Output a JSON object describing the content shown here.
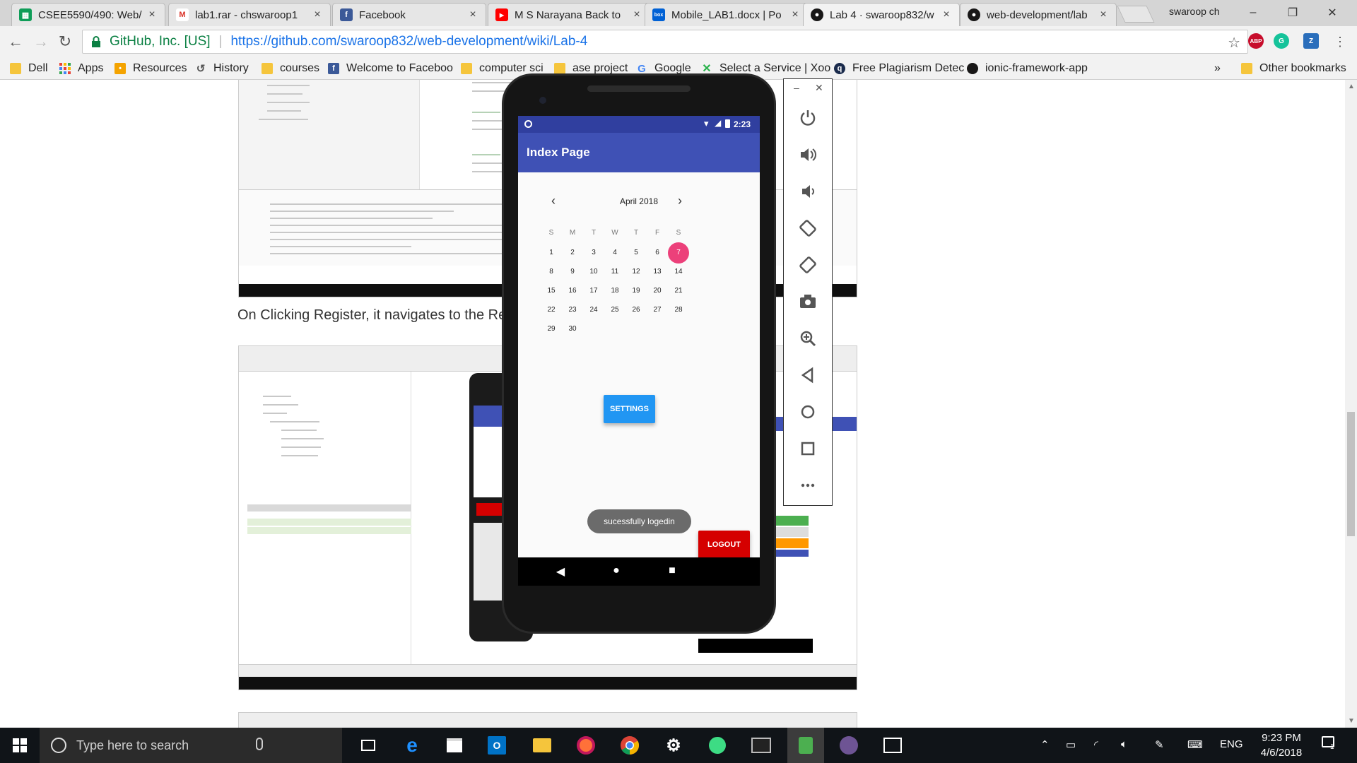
{
  "browser": {
    "tabs": [
      {
        "title": "CSEE5590/490: Web/C",
        "favicon_color": "#0f9d58",
        "favicon_text": ""
      },
      {
        "title": "lab1.rar - chswaroop1",
        "favicon_color": "#d93025",
        "favicon_text": "M"
      },
      {
        "title": "Facebook",
        "favicon_color": "#3b5998",
        "favicon_text": "f"
      },
      {
        "title": "M S Narayana Back to",
        "favicon_color": "#ff0000",
        "favicon_text": "▶"
      },
      {
        "title": "Mobile_LAB1.docx | Po",
        "favicon_color": "#0061d5",
        "favicon_text": "box"
      },
      {
        "title": "Lab 4 · swaroop832/w",
        "favicon_color": "#181717",
        "favicon_text": ""
      },
      {
        "title": "web-development/lab",
        "favicon_color": "#181717",
        "favicon_text": ""
      }
    ],
    "profile_name": "swaroop ch",
    "window_controls": {
      "minimize": "–",
      "restore": "❐",
      "close": "✕"
    },
    "address": {
      "site_identity": "GitHub, Inc. [US]",
      "separator": "|",
      "url": "https://github.com/swaroop832/web-development/wiki/Lab-4"
    },
    "extensions": [
      {
        "name": "adblock-plus",
        "text": "ABP",
        "color": "#c70d2c"
      },
      {
        "name": "grammarly",
        "text": "G",
        "color": "#15c39a"
      },
      {
        "name": "zotero",
        "text": "Z",
        "color": "#2a6ebb"
      }
    ],
    "bookmarks": [
      {
        "label": "Dell",
        "icon": "folder"
      },
      {
        "label": "Apps",
        "icon": "apps-grid"
      },
      {
        "label": "Resources",
        "icon": "resources"
      },
      {
        "label": "History",
        "icon": "history"
      },
      {
        "label": "courses",
        "icon": "folder"
      },
      {
        "label": "Welcome to Faceboo",
        "icon": "facebook"
      },
      {
        "label": "computer sci",
        "icon": "folder"
      },
      {
        "label": "ase project",
        "icon": "folder"
      },
      {
        "label": "Google",
        "icon": "google"
      },
      {
        "label": "Select a Service | Xoo",
        "icon": "xoom"
      },
      {
        "label": "Free Plagiarism Detec",
        "icon": "plagiarism"
      },
      {
        "label": "ionic-framework-app",
        "icon": "github"
      }
    ],
    "bookmarks_overflow": "»",
    "other_bookmarks": "Other bookmarks"
  },
  "page": {
    "caption": "On Clicking Register, it navigates to the Reg"
  },
  "emulator": {
    "status_time": "2:23",
    "app_title": "Index Page",
    "calendar": {
      "month_label": "April 2018",
      "weekdays": [
        "S",
        "M",
        "T",
        "W",
        "T",
        "F",
        "S"
      ],
      "days": [
        "1",
        "2",
        "3",
        "4",
        "5",
        "6",
        "7",
        "8",
        "9",
        "10",
        "11",
        "12",
        "13",
        "14",
        "15",
        "16",
        "17",
        "18",
        "19",
        "20",
        "21",
        "22",
        "23",
        "24",
        "25",
        "26",
        "27",
        "28",
        "29",
        "30"
      ],
      "selected_day": "7",
      "selected_color": "#ec407a"
    },
    "settings_label": "SETTINGS",
    "toast_text": "sucessfully logedin",
    "logout_label": "LOGOUT",
    "panel_controls": [
      "power-icon",
      "volume-up-icon",
      "volume-down-icon",
      "rotate-left-icon",
      "rotate-right-icon",
      "camera-icon",
      "zoom-icon",
      "back-icon",
      "home-icon",
      "overview-icon",
      "more-icon"
    ]
  },
  "taskbar": {
    "search_placeholder": "Type here to search",
    "language": "ENG",
    "time": "9:23 PM",
    "date": "4/6/2018",
    "notification_count": "1"
  }
}
